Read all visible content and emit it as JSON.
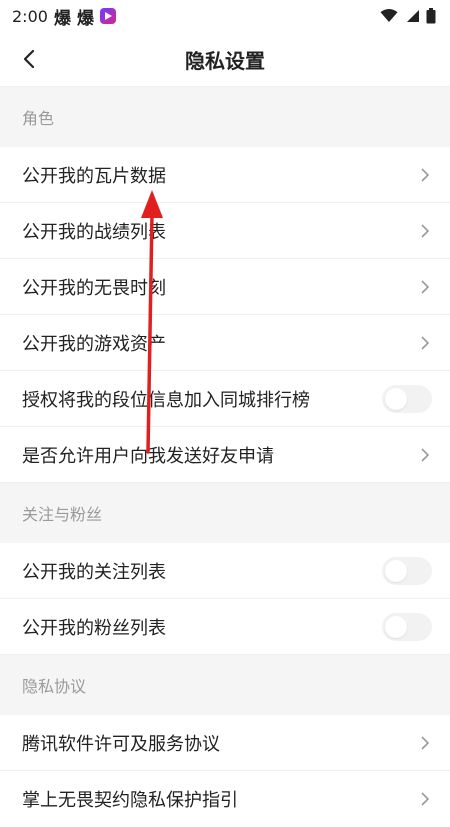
{
  "status_bar": {
    "time": "2:00",
    "glyph1": "爆",
    "glyph2": "爆",
    "icons": [
      "wifi-icon",
      "signal-icon",
      "battery-icon"
    ]
  },
  "nav": {
    "title": "隐私设置",
    "back_icon": "chevron-left-icon"
  },
  "sections": [
    {
      "header": "角色",
      "rows": [
        {
          "label": "公开我的瓦片数据",
          "control": "chevron"
        },
        {
          "label": "公开我的战绩列表",
          "control": "chevron"
        },
        {
          "label": "公开我的无畏时刻",
          "control": "chevron"
        },
        {
          "label": "公开我的游戏资产",
          "control": "chevron"
        },
        {
          "label": "授权将我的段位信息加入同城排行榜",
          "control": "toggle",
          "on": false
        },
        {
          "label": "是否允许用户向我发送好友申请",
          "control": "chevron"
        }
      ]
    },
    {
      "header": "关注与粉丝",
      "rows": [
        {
          "label": "公开我的关注列表",
          "control": "toggle",
          "on": false
        },
        {
          "label": "公开我的粉丝列表",
          "control": "toggle",
          "on": false
        }
      ]
    },
    {
      "header": "隐私协议",
      "rows": [
        {
          "label": "腾讯软件许可及服务协议",
          "control": "chevron"
        },
        {
          "label": "掌上无畏契约隐私保护指引",
          "control": "chevron"
        }
      ]
    }
  ],
  "colors": {
    "section_bg": "#f5f5f5",
    "header_text": "#9a9a9a",
    "annotation_arrow": "#e0201f"
  }
}
